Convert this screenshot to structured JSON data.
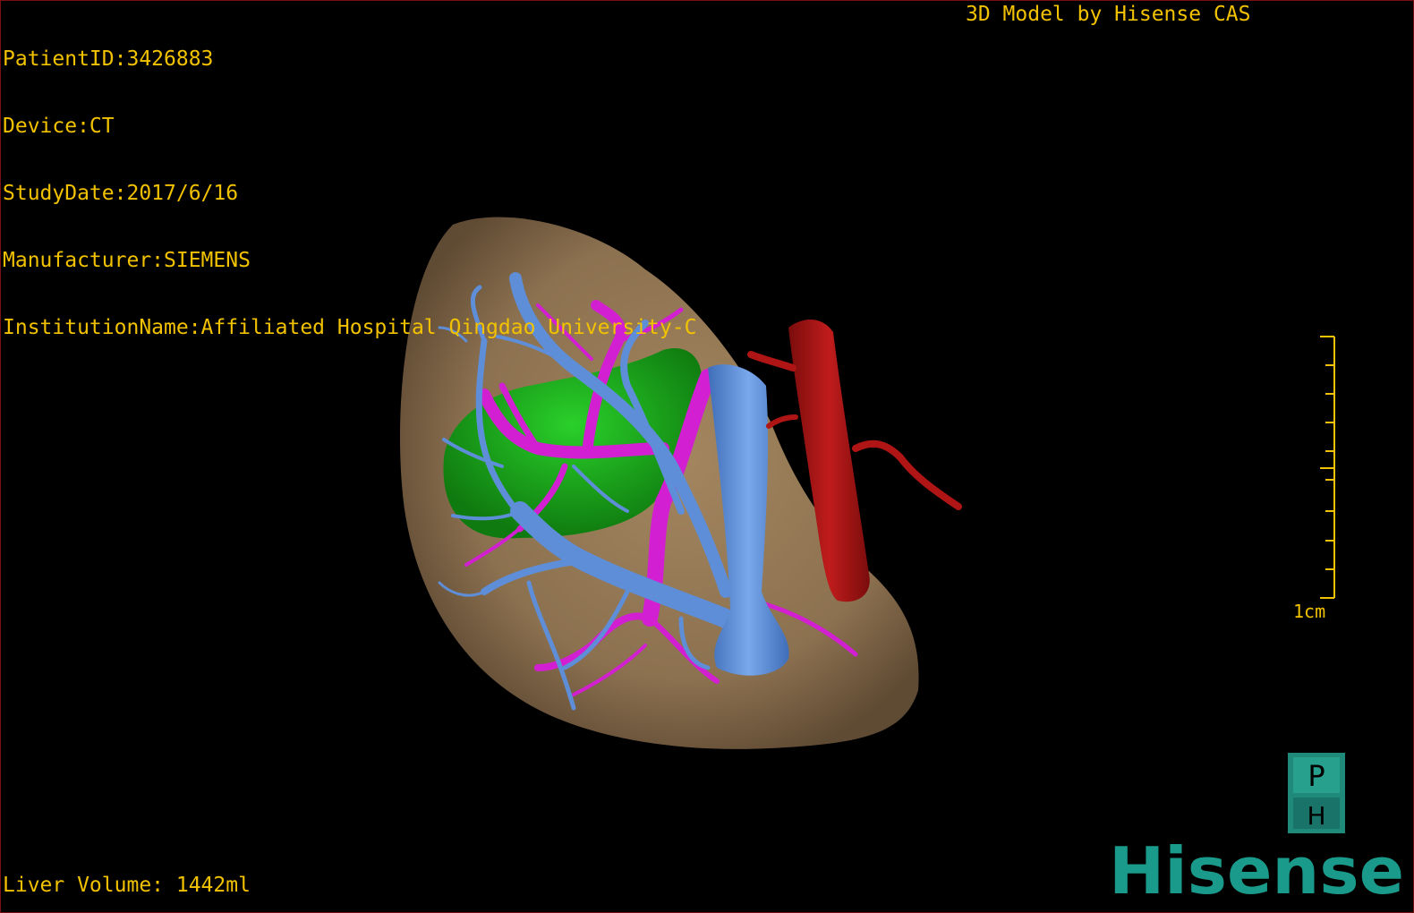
{
  "info": {
    "patient_id": "PatientID:3426883",
    "device": "Device:CT",
    "study_date": "StudyDate:2017/6/16",
    "manufacturer": "Manufacturer:SIEMENS",
    "institution": "InstitutionName:Affiliated Hospital Qingdao University-C"
  },
  "credit": "3D Model by Hisense CAS",
  "liver_volume": "Liver Volume: 1442ml",
  "scale": {
    "label": "1cm"
  },
  "orientation": {
    "top": "P",
    "bottom": "H"
  },
  "logo": {
    "text": "Hisense"
  },
  "colors": {
    "overlay_text": "#f2c200",
    "liver": "#8c7150",
    "tumor": "#1aa61a",
    "hepatic_vein": "#5e8ed8",
    "portal_vein": "#d21fd2",
    "vena_cava": "#5e8ed8",
    "aorta": "#b01515",
    "logo": "#1a9a8a",
    "cube_fill": "#1f8a7a"
  }
}
